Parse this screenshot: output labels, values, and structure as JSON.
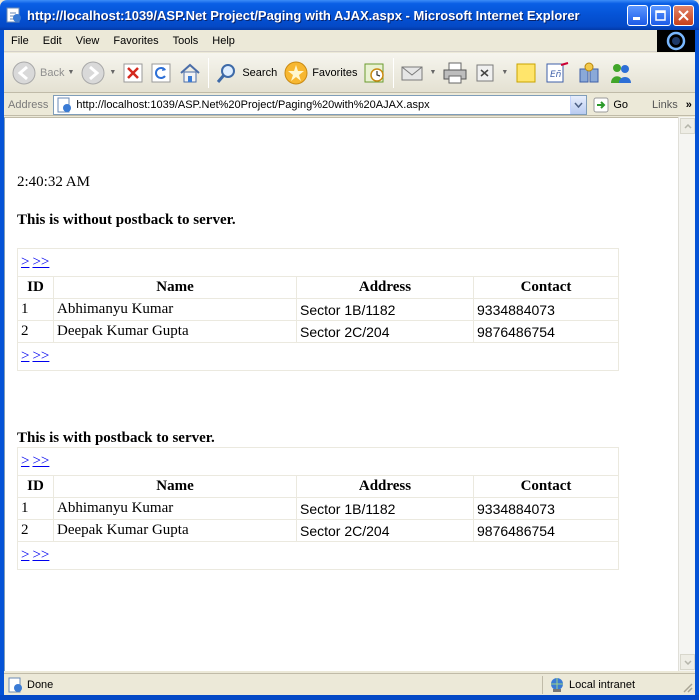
{
  "window": {
    "title": "http://localhost:1039/ASP.Net Project/Paging with AJAX.aspx - Microsoft Internet Explorer"
  },
  "menu": [
    "File",
    "Edit",
    "View",
    "Favorites",
    "Tools",
    "Help"
  ],
  "toolbar": {
    "back_label": "Back",
    "search_label": "Search",
    "favorites_label": "Favorites"
  },
  "address": {
    "label": "Address",
    "url": "http://localhost:1039/ASP.Net%20Project/Paging%20with%20AJAX.aspx",
    "go_label": "Go",
    "links_label": "Links",
    "links_chevron": "»"
  },
  "page": {
    "time": "2:40:32 AM",
    "section1_caption": "This is without postback to server.",
    "section2_caption": "This is with postback to server.",
    "pager": {
      "next": ">",
      "last": ">>"
    },
    "columns": [
      "ID",
      "Name",
      "Address",
      "Contact"
    ],
    "rows": [
      [
        "1",
        "Abhimanyu Kumar",
        "Sector 1B/1182",
        "9334884073"
      ],
      [
        "2",
        "Deepak Kumar Gupta",
        "Sector 2C/204",
        "9876486754"
      ]
    ]
  },
  "status": {
    "text": "Done",
    "zone": "Local intranet"
  }
}
